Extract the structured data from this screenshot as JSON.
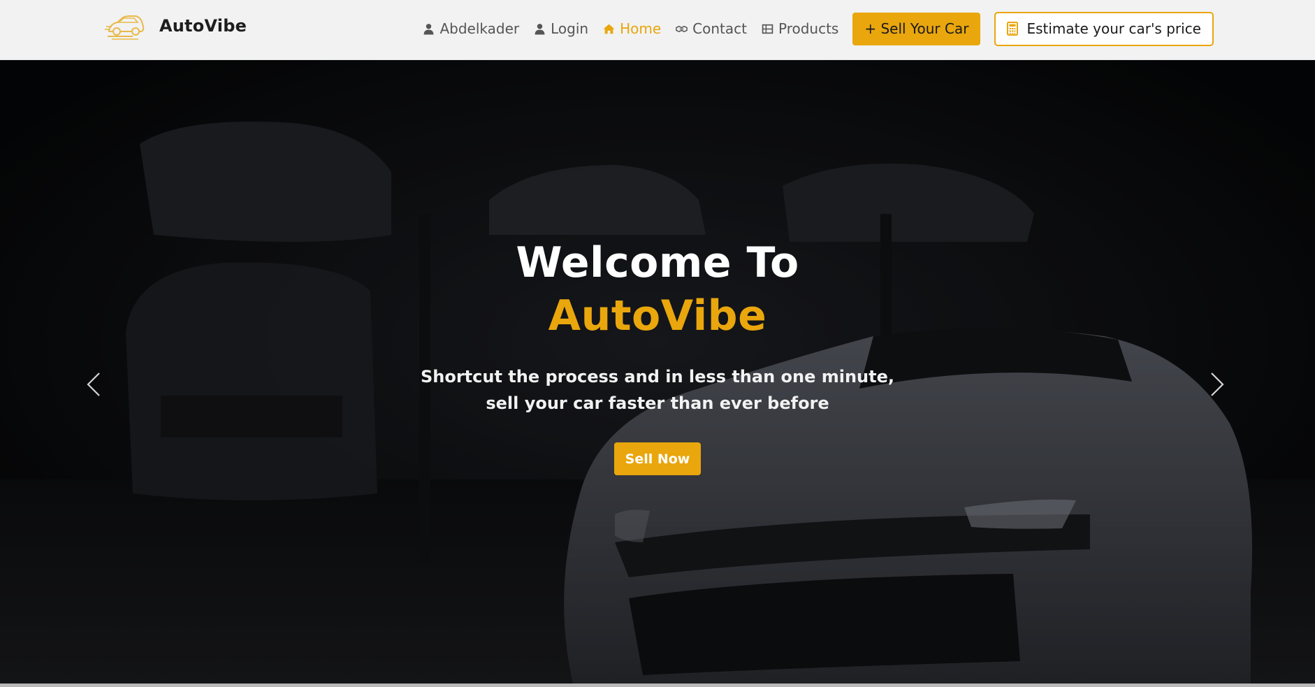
{
  "brand": {
    "name": "AutoVibe",
    "logo_icon": "car-logo-icon",
    "accent_color": "#e9a60d"
  },
  "nav": {
    "user": {
      "label": "Abdelkader",
      "icon": "user-icon"
    },
    "login": {
      "label": "Login",
      "icon": "user-icon"
    },
    "home": {
      "label": "Home",
      "icon": "home-icon",
      "active": true
    },
    "contact": {
      "label": "Contact",
      "icon": "handshake-icon"
    },
    "products": {
      "label": "Products",
      "icon": "grid-icon"
    },
    "sell_car": {
      "label": "+ Sell Your Car"
    },
    "estimate": {
      "label": "Estimate your car's price",
      "icon": "calculator-icon"
    }
  },
  "hero": {
    "title_line1": "Welcome To",
    "title_line2": "AutoVibe",
    "subtitle_line1": "Shortcut the process and in less than one minute,",
    "subtitle_line2": "sell your car faster than ever before",
    "cta_label": "Sell Now",
    "prev_icon": "chevron-left-icon",
    "next_icon": "chevron-right-icon",
    "background_image": "dark garage with sports cars"
  }
}
